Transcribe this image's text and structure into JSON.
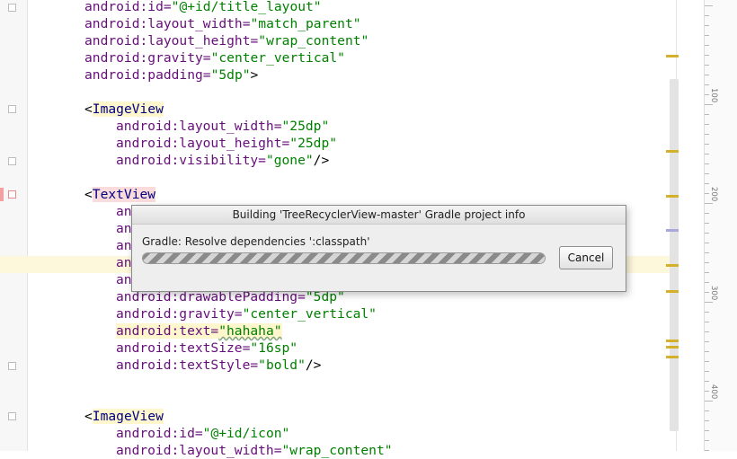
{
  "editor": {
    "lines": [
      {
        "parts": [
          {
            "t": "android:id=",
            "c": "a"
          },
          {
            "t": "\"@+id/title_layout\"",
            "c": "v"
          }
        ]
      },
      {
        "parts": [
          {
            "t": "android:layout_width=",
            "c": "a"
          },
          {
            "t": "\"match_parent\"",
            "c": "v"
          }
        ]
      },
      {
        "parts": [
          {
            "t": "android:layout_height=",
            "c": "a"
          },
          {
            "t": "\"wrap_content\"",
            "c": "v"
          }
        ]
      },
      {
        "parts": [
          {
            "t": "android:gravity=",
            "c": "a"
          },
          {
            "t": "\"center_vertical\"",
            "c": "v"
          }
        ]
      },
      {
        "parts": [
          {
            "t": "android:padding=",
            "c": "a"
          },
          {
            "t": "\"5dp\"",
            "c": "v"
          },
          {
            "t": ">",
            "c": "p"
          }
        ]
      },
      {
        "parts": []
      },
      {
        "parts": [
          {
            "t": "<",
            "c": "p"
          },
          {
            "t": "ImageView",
            "c": "tag tagbg"
          }
        ]
      },
      {
        "parts": [
          {
            "t": "android:layout_width=",
            "c": "a"
          },
          {
            "t": "\"25dp\"",
            "c": "v"
          }
        ],
        "in": true
      },
      {
        "parts": [
          {
            "t": "android:layout_height=",
            "c": "a"
          },
          {
            "t": "\"25dp\"",
            "c": "v"
          }
        ],
        "in": true
      },
      {
        "parts": [
          {
            "t": "android:visibility=",
            "c": "a"
          },
          {
            "t": "\"gone\"",
            "c": "v"
          },
          {
            "t": "/>",
            "c": "p"
          }
        ],
        "in": true
      },
      {
        "parts": []
      },
      {
        "parts": [
          {
            "t": "<",
            "c": "p"
          },
          {
            "t": "TextView",
            "c": "tag tagbg err"
          }
        ]
      },
      {
        "parts": [
          {
            "t": "an",
            "c": "a"
          }
        ],
        "in": true
      },
      {
        "parts": [
          {
            "t": "an",
            "c": "a"
          }
        ],
        "in": true
      },
      {
        "parts": [
          {
            "t": "an",
            "c": "a"
          }
        ],
        "in": true
      },
      {
        "parts": [
          {
            "t": "an",
            "c": "a"
          }
        ],
        "in": true
      },
      {
        "parts": [
          {
            "t": "an",
            "c": "a"
          }
        ],
        "in": true
      },
      {
        "parts": [
          {
            "t": "android:drawablePadding=",
            "c": "a"
          },
          {
            "t": "\"5dp\"",
            "c": "v"
          }
        ],
        "in": true
      },
      {
        "parts": [
          {
            "t": "android:gravity=",
            "c": "a"
          },
          {
            "t": "\"center_vertical\"",
            "c": "v"
          }
        ],
        "in": true
      },
      {
        "parts": [
          {
            "t": "android:text=",
            "c": "a textattr"
          },
          {
            "t": "\"hahaha\"",
            "c": "v textattr squig"
          }
        ],
        "in": true
      },
      {
        "parts": [
          {
            "t": "android:textSize=",
            "c": "a"
          },
          {
            "t": "\"16sp\"",
            "c": "v"
          }
        ],
        "in": true
      },
      {
        "parts": [
          {
            "t": "android:textStyle=",
            "c": "a"
          },
          {
            "t": "\"bold\"",
            "c": "v"
          },
          {
            "t": "/>",
            "c": "p"
          }
        ],
        "in": true
      },
      {
        "parts": []
      },
      {
        "parts": []
      },
      {
        "parts": [
          {
            "t": "<",
            "c": "p"
          },
          {
            "t": "ImageView",
            "c": "tag tagbg"
          }
        ]
      },
      {
        "parts": [
          {
            "t": "android:id=",
            "c": "a"
          },
          {
            "t": "\"@+id/icon\"",
            "c": "v"
          }
        ],
        "in": true
      },
      {
        "parts": [
          {
            "t": "android:layout_width=",
            "c": "a"
          },
          {
            "t": "\"wrap_content\"",
            "c": "v"
          }
        ],
        "in": true
      }
    ]
  },
  "ruler": {
    "labels": [
      "100",
      "200",
      "300",
      "400"
    ]
  },
  "dialog": {
    "title": "Building 'TreeRecyclerView-master' Gradle project info",
    "message": "Gradle: Resolve dependencies ':classpath'",
    "cancel_label": "Cancel"
  },
  "colors": {
    "attribute": "#660e7a",
    "value": "#008000",
    "tag": "#000080",
    "marker": "#d4b12b"
  }
}
